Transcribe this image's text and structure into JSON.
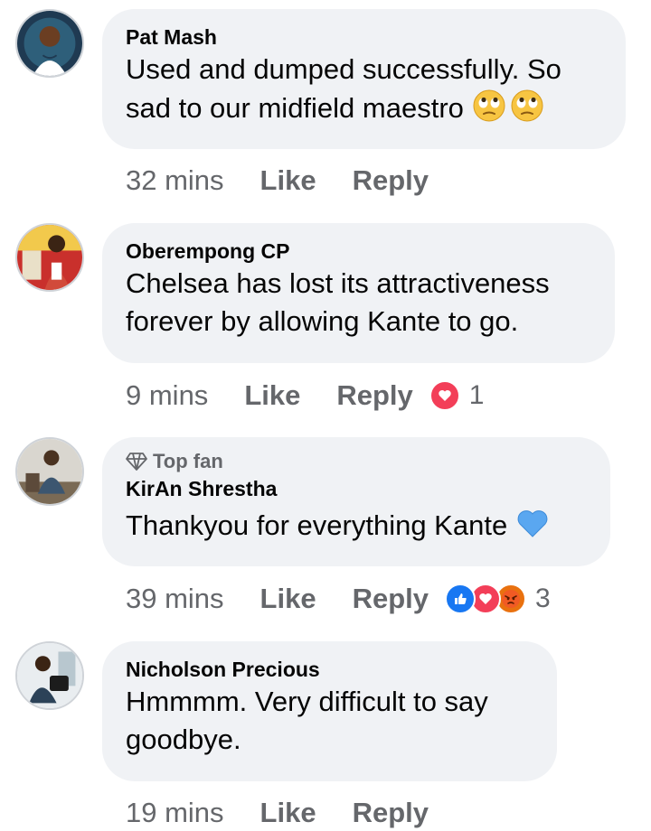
{
  "comments": [
    {
      "name": "Pat Mash",
      "text": "Used and dumped successfully. So\nsad to our midfield maestro",
      "time": "32 mins",
      "like": "Like",
      "reply": "Reply"
    },
    {
      "name": "Oberempong CP",
      "text": "Chelsea has lost its attractiveness\nforever by allowing Kante to go.",
      "time": "9 mins",
      "like": "Like",
      "reply": "Reply",
      "reaction_count": "1"
    },
    {
      "badge": "Top fan",
      "name": "KirAn Shrestha",
      "text": "Thankyou for everything Kante",
      "time": "39 mins",
      "like": "Like",
      "reply": "Reply",
      "reaction_count": "3"
    },
    {
      "name": "Nicholson Precious",
      "text": "Hmmmm. Very difficult to say\ngoodbye.",
      "time": "19 mins",
      "like": "Like",
      "reply": "Reply"
    }
  ],
  "colors": {
    "bubble": "#f0f2f5",
    "meta_text": "#65676b",
    "like_reaction": "#1877f2",
    "love_reaction": "#f33e58",
    "angry_reaction": "#e9710f"
  },
  "icons": [
    "rolling-eyes-emoji",
    "blue-heart-emoji",
    "diamond-icon",
    "like-reaction-icon",
    "love-reaction-icon",
    "angry-reaction-icon"
  ]
}
